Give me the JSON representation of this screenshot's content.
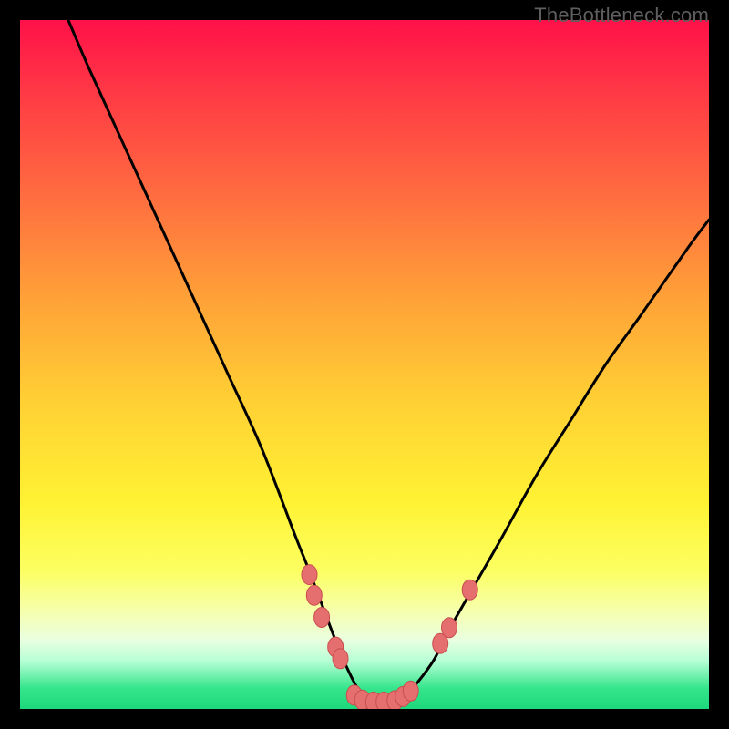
{
  "attribution": {
    "text": "TheBottleneck.com"
  },
  "colors": {
    "frame": "#000000",
    "curve_stroke": "#000000",
    "marker_fill": "#e56e6e",
    "marker_stroke": "#c94f4f",
    "gradient_stops": [
      "#ff1149",
      "#ff3745",
      "#ff6b40",
      "#ffa038",
      "#ffcf34",
      "#fff233",
      "#fcff62",
      "#f6ffb0",
      "#e9ffe0",
      "#b7ffd6",
      "#35e58b",
      "#1dd87c"
    ]
  },
  "chart_data": {
    "type": "line",
    "title": "",
    "xlabel": "",
    "ylabel": "",
    "xlim": [
      0,
      100
    ],
    "ylim": [
      0,
      100
    ],
    "grid": false,
    "legend": false,
    "series": [
      {
        "name": "bottleneck-curve",
        "x": [
          7,
          10,
          15,
          20,
          25,
          30,
          35,
          40,
          42,
          45,
          47,
          49,
          51,
          53,
          55,
          57,
          60,
          62,
          66,
          70,
          75,
          80,
          85,
          90,
          97,
          100
        ],
        "values": [
          100,
          93,
          82,
          71,
          60,
          49,
          38,
          25,
          20,
          12,
          7,
          3,
          1,
          1,
          1,
          3,
          7,
          11,
          18,
          25,
          34,
          42,
          50,
          57,
          67,
          71
        ]
      }
    ],
    "markers": [
      {
        "name": "left-cluster-top",
        "x": 42.0,
        "y": 19.5
      },
      {
        "name": "left-cluster-upper",
        "x": 42.7,
        "y": 16.5
      },
      {
        "name": "left-cluster-mid",
        "x": 43.8,
        "y": 13.3
      },
      {
        "name": "left-cluster-low",
        "x": 45.8,
        "y": 9.0
      },
      {
        "name": "left-cluster-lower",
        "x": 46.5,
        "y": 7.3
      },
      {
        "name": "valley-left-a",
        "x": 48.5,
        "y": 2.0
      },
      {
        "name": "valley-left-b",
        "x": 49.7,
        "y": 1.3
      },
      {
        "name": "valley-center-a",
        "x": 51.3,
        "y": 1.0
      },
      {
        "name": "valley-center-b",
        "x": 52.8,
        "y": 1.0
      },
      {
        "name": "valley-right-a",
        "x": 54.4,
        "y": 1.2
      },
      {
        "name": "valley-right-b",
        "x": 55.6,
        "y": 1.8
      },
      {
        "name": "valley-right-c",
        "x": 56.7,
        "y": 2.6
      },
      {
        "name": "right-cluster-low",
        "x": 61.0,
        "y": 9.5
      },
      {
        "name": "right-cluster-mid",
        "x": 62.3,
        "y": 11.8
      },
      {
        "name": "right-cluster-high",
        "x": 65.3,
        "y": 17.3
      }
    ]
  }
}
